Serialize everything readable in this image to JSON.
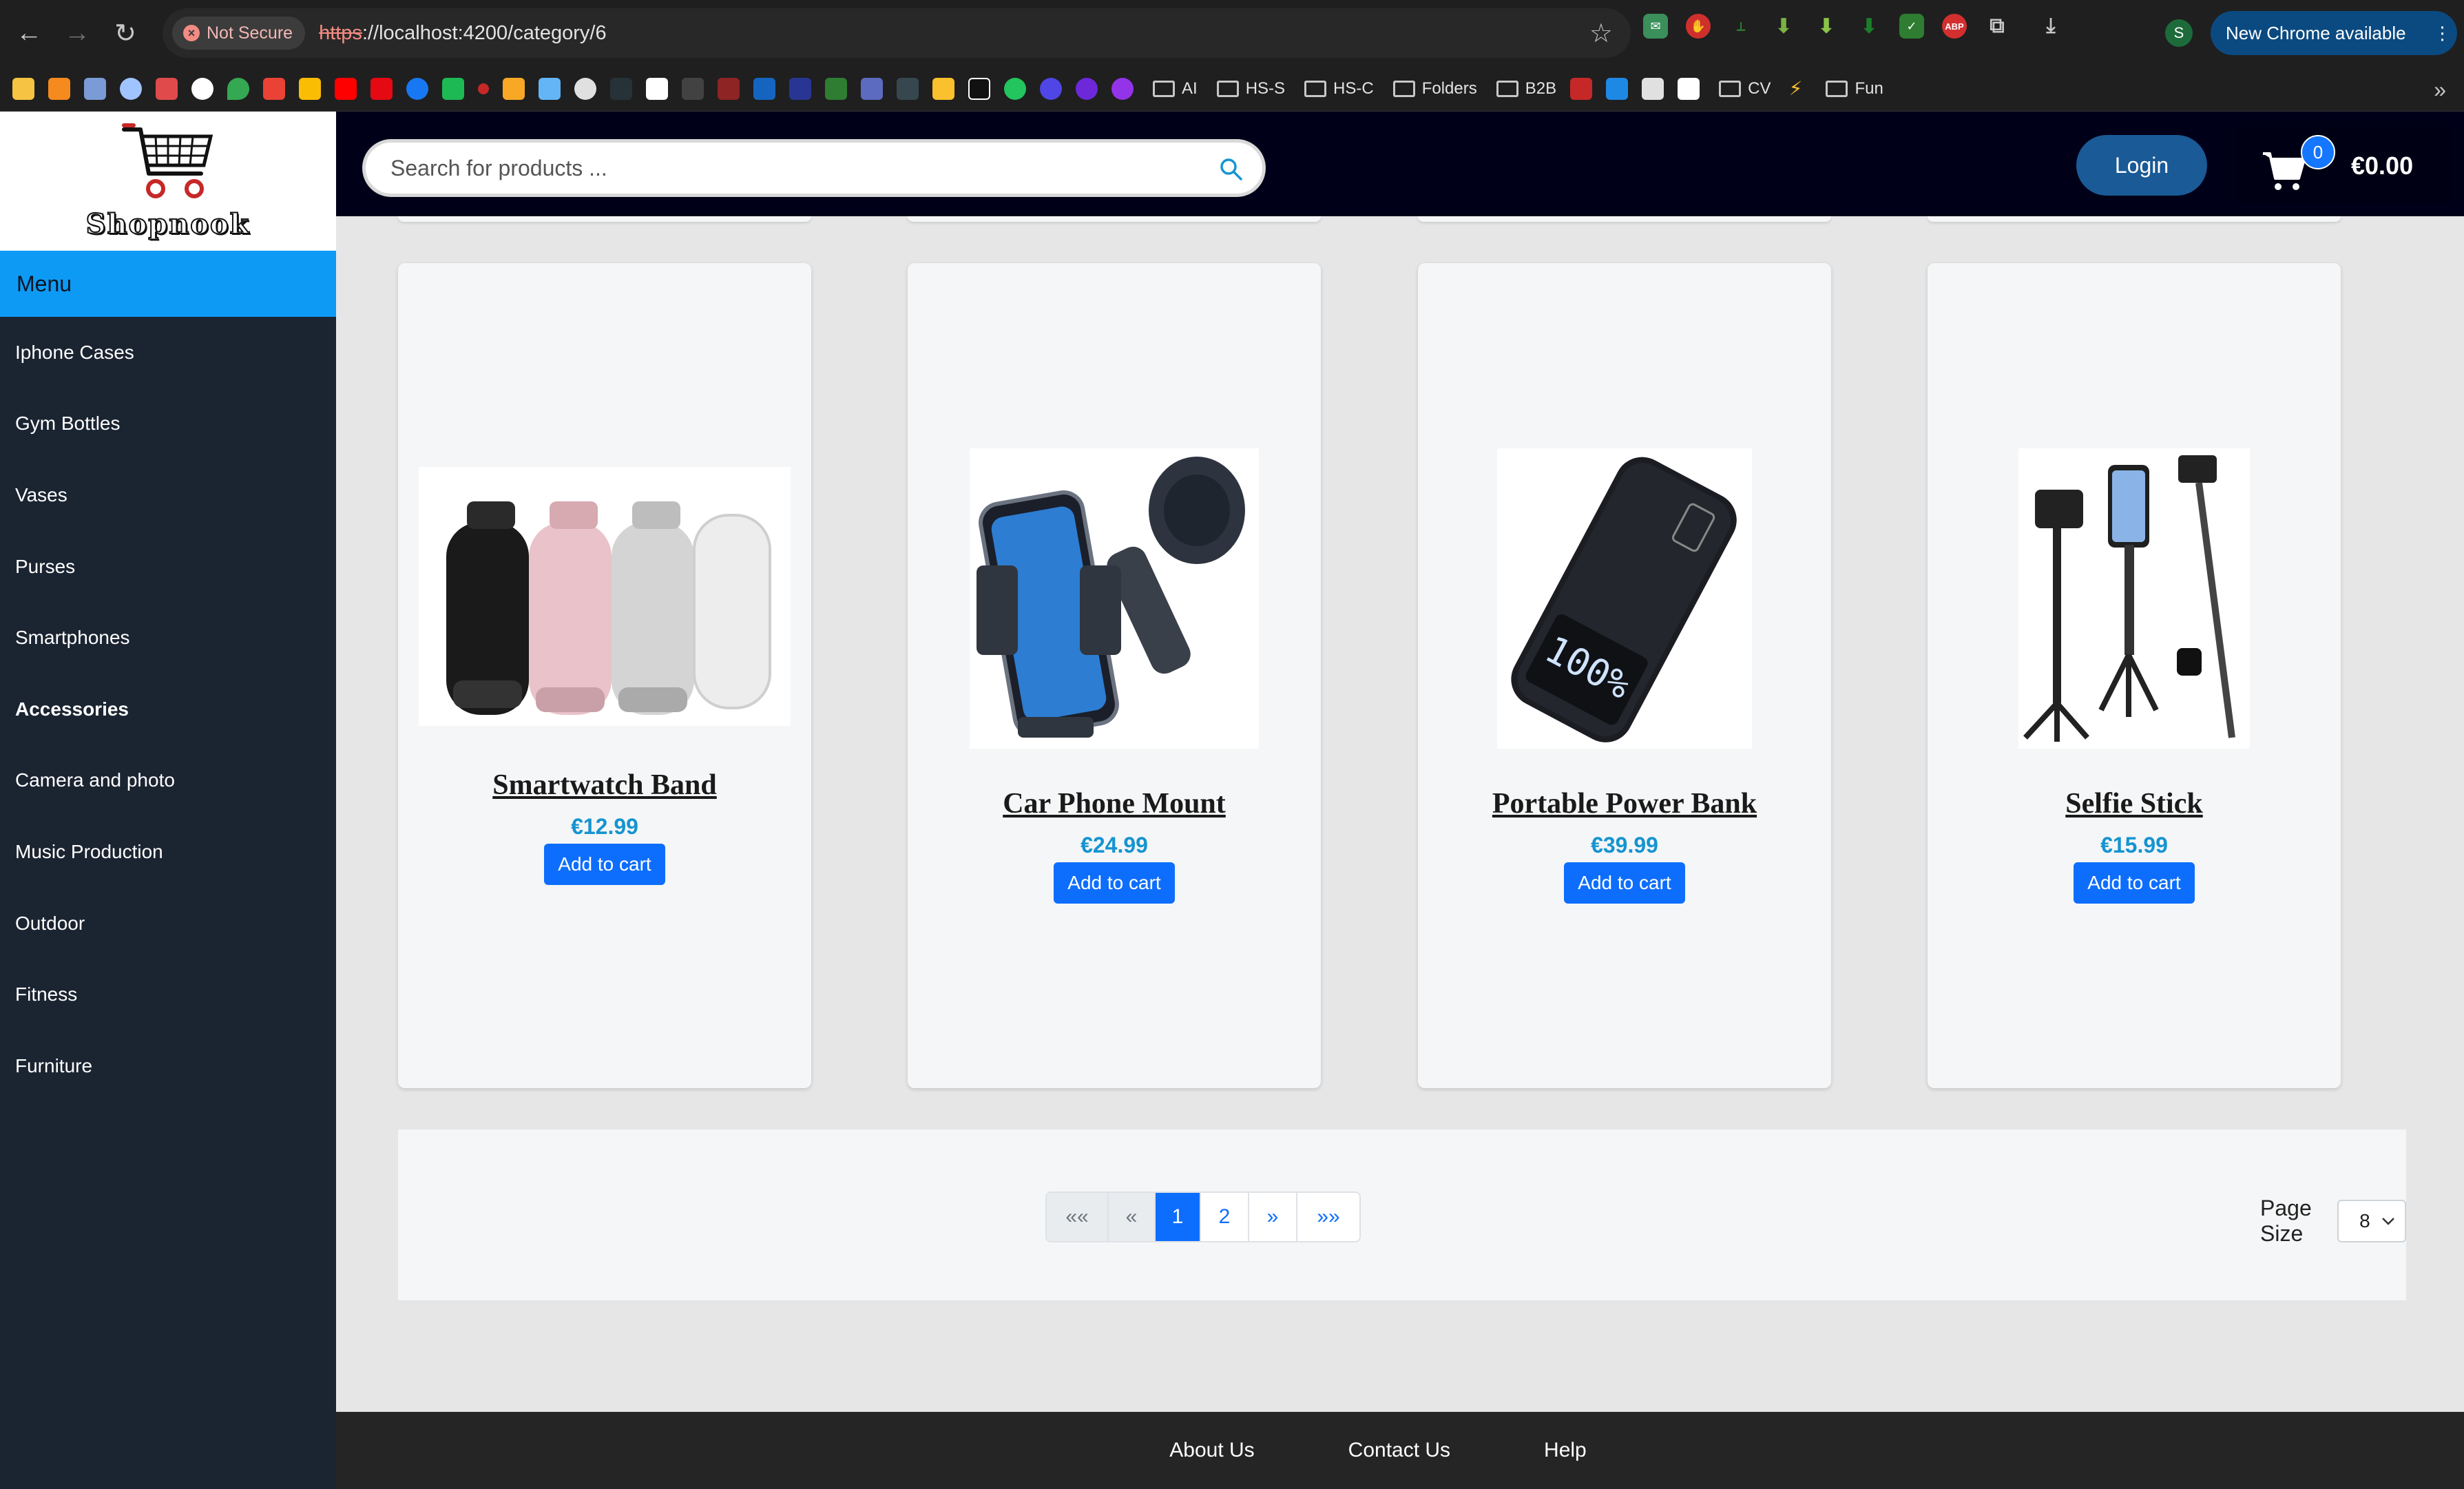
{
  "browser": {
    "security_label": "Not Secure",
    "url_scheme": "https",
    "url_rest": "://localhost:4200/category/6",
    "profile_initial": "S",
    "update_label": "New Chrome available",
    "bookmark_folders": [
      "AI",
      "HS-S",
      "HS-C",
      "Folders",
      "B2B",
      "CV",
      "Fun"
    ]
  },
  "app": {
    "logo_text": "Shopnook",
    "menu_title": "Menu",
    "menu_items": [
      "Iphone Cases",
      "Gym Bottles",
      "Vases",
      "Purses",
      "Smartphones",
      "Accessories",
      "Camera and photo",
      "Music Production",
      "Outdoor",
      "Fitness",
      "Furniture"
    ],
    "active_menu": "Accessories",
    "search_placeholder": "Search for products ...",
    "login_label": "Login",
    "cart_count": "0",
    "cart_total": "€0.00"
  },
  "products": [
    {
      "name": "Smartwatch Band",
      "price": "€12.99",
      "button": "Add to cart",
      "icon": "watch-band-image"
    },
    {
      "name": "Car Phone Mount",
      "price": "€24.99",
      "button": "Add to cart",
      "icon": "car-mount-image"
    },
    {
      "name": "Portable Power Bank",
      "price": "€39.99",
      "button": "Add to cart",
      "icon": "power-bank-image"
    },
    {
      "name": "Selfie Stick",
      "price": "€15.99",
      "button": "Add to cart",
      "icon": "selfie-stick-image"
    }
  ],
  "pagination": {
    "first": "«« ",
    "prev": "«",
    "pages": [
      "1",
      "2"
    ],
    "current_page": "1",
    "next": "»",
    "last": "»»",
    "page_size_label": "Page Size",
    "page_size_value": "8"
  },
  "footer": {
    "links": [
      "About Us",
      "Contact Us",
      "Help"
    ]
  },
  "colors": {
    "sidebar": "#1b2431",
    "menu_header": "#0d9af5",
    "topbar": "#000019",
    "primary_button": "#0d6efd",
    "price": "#1594d1"
  }
}
